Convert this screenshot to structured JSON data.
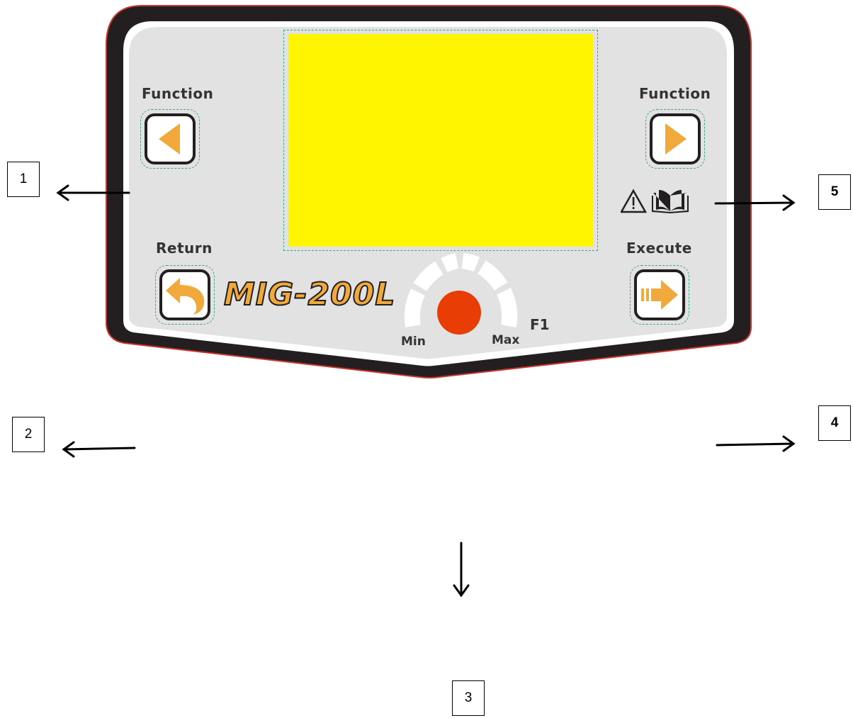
{
  "panel": {
    "model_name": "MIG-200L",
    "display_color": "#fff500",
    "accent_color": "#f2a93b",
    "knob_color": "#e83e05"
  },
  "buttons": {
    "function_left": {
      "label": "Function",
      "icon": "triangle-left-icon"
    },
    "function_right": {
      "label": "Function",
      "icon": "triangle-right-icon"
    },
    "return": {
      "label": "Return",
      "icon": "return-arrow-icon"
    },
    "execute": {
      "label": "Execute",
      "icon": "execute-arrow-icon"
    }
  },
  "knob": {
    "min_label": "Min",
    "max_label": "Max",
    "function_label": "F1"
  },
  "warning_icons": [
    "warning-triangle-icon",
    "manual-book-icon"
  ],
  "callouts": [
    {
      "id": "1",
      "text": "1"
    },
    {
      "id": "2",
      "text": "2"
    },
    {
      "id": "3",
      "text": "3"
    },
    {
      "id": "4",
      "text": "4"
    },
    {
      "id": "5",
      "text": "5"
    }
  ]
}
